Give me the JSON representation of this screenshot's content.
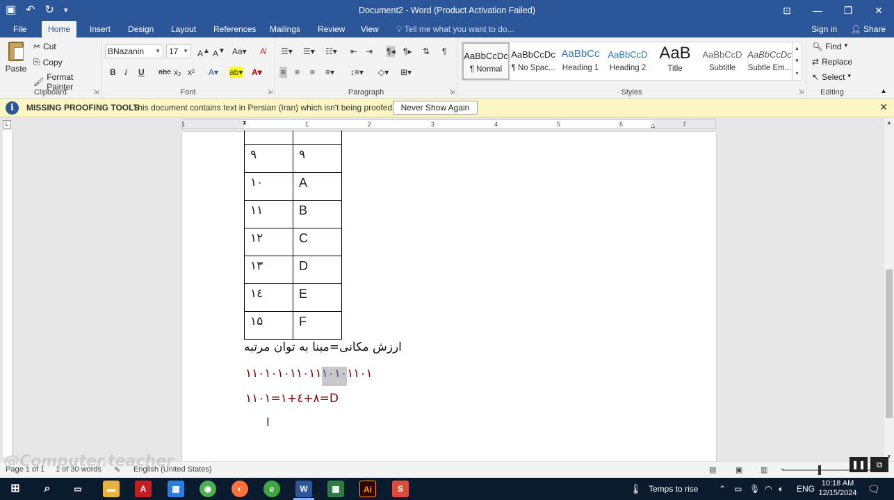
{
  "window": {
    "title": "Document2 - Word (Product Activation Failed)"
  },
  "tabs": [
    {
      "label": "File"
    },
    {
      "label": "Home"
    },
    {
      "label": "Insert"
    },
    {
      "label": "Design"
    },
    {
      "label": "Layout"
    },
    {
      "label": "References"
    },
    {
      "label": "Mailings"
    },
    {
      "label": "Review"
    },
    {
      "label": "View"
    }
  ],
  "tell_me": "Tell me what you want to do...",
  "account": {
    "signin": "Sign in",
    "share": "Share"
  },
  "clipboard": {
    "paste": "Paste",
    "cut": "Cut",
    "copy": "Copy",
    "format_painter": "Format Painter",
    "label": "Clipboard"
  },
  "font": {
    "name": "BNazanin",
    "size": "17",
    "bold": "B",
    "italic": "I",
    "underline": "U",
    "strike": "abc",
    "subscript": "x₂",
    "superscript": "x²",
    "label": "Font"
  },
  "paragraph": {
    "label": "Paragraph"
  },
  "styles": {
    "items": [
      {
        "preview": "AaBbCcDc",
        "name": "¶ Normal"
      },
      {
        "preview": "AaBbCcDc",
        "name": "¶ No Spac..."
      },
      {
        "preview": "AaBbCc",
        "name": "Heading 1"
      },
      {
        "preview": "AaBbCcD",
        "name": "Heading 2"
      },
      {
        "preview": "AaB",
        "name": "Title"
      },
      {
        "preview": "AaBbCcD",
        "name": "Subtitle"
      },
      {
        "preview": "AaBbCcDc",
        "name": "Subtle Em..."
      }
    ],
    "label": "Styles"
  },
  "editing": {
    "find": "Find",
    "replace": "Replace",
    "select": "Select",
    "label": "Editing"
  },
  "message_bar": {
    "title": "MISSING PROOFING TOOLS",
    "text": "This document contains text in Persian (Iran) which isn't being proofed.",
    "button": "Never Show Again"
  },
  "ruler": {
    "numbers": [
      "1",
      "1",
      "2",
      "3",
      "4",
      "5",
      "6",
      "7"
    ]
  },
  "document": {
    "table_rows": [
      {
        "left": "",
        "right": ""
      },
      {
        "left": "۹",
        "right": "۹"
      },
      {
        "left": "۱۰",
        "right": "A"
      },
      {
        "left": "۱۱",
        "right": "B"
      },
      {
        "left": "۱۲",
        "right": "C"
      },
      {
        "left": "۱۳",
        "right": "D"
      },
      {
        "left": "۱٤",
        "right": "E"
      },
      {
        "left": "۱۵",
        "right": "F"
      }
    ],
    "line1": "ارزش مکانی=مبنا به توان مرتبه",
    "line2_pre": "۱۱۰۱۰۱۰۱۱۰۱۱",
    "line2_hl": "۱۰۱۰",
    "line2_post": "۱۱۰۱",
    "line3": "۱۱۰۱=۱+٤+۸=D"
  },
  "status": {
    "page": "Page 1 of 1",
    "words": "1 of 30 words",
    "language": "English (United States)"
  },
  "watermark": "Computer.teacher",
  "taskbar": {
    "weather": "Temps to rise",
    "lang": "ENG",
    "time": "10:18 AM",
    "date": "12/15/2024"
  },
  "colors": {
    "word_blue": "#2b579a",
    "message_bar": "#fcf6c4",
    "red_text": "#8b0000"
  }
}
